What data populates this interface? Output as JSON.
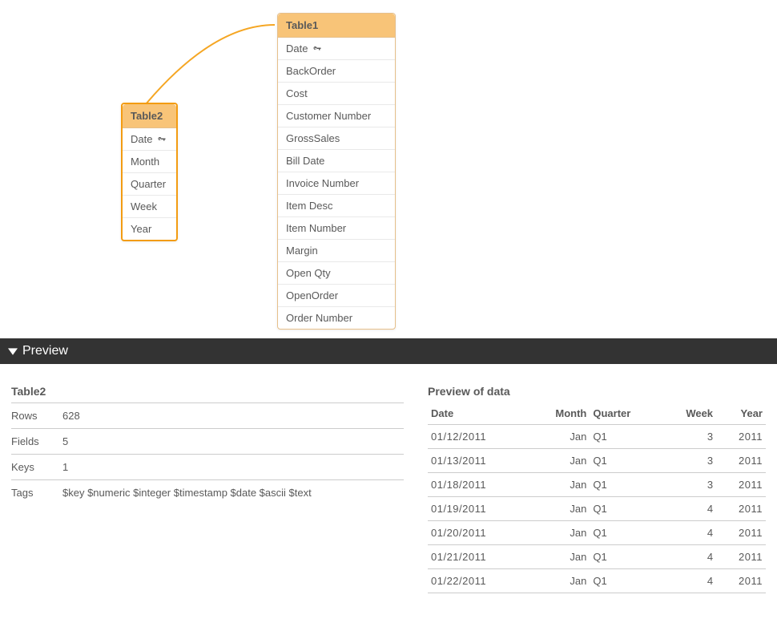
{
  "canvas": {
    "table1": {
      "title": "Table1",
      "fields": [
        "Date",
        "BackOrder",
        "Cost",
        "Customer Number",
        "GrossSales",
        "Bill Date",
        "Invoice Number",
        "Item Desc",
        "Item Number",
        "Margin",
        "Open Qty",
        "OpenOrder",
        "Order Number"
      ],
      "key_field_index": 0
    },
    "table2": {
      "title": "Table2",
      "fields": [
        "Date",
        "Month",
        "Quarter",
        "Week",
        "Year"
      ],
      "key_field_index": 0
    }
  },
  "preview": {
    "header_label": "Preview",
    "meta": {
      "title": "Table2",
      "rows_label": "Rows",
      "rows_value": "628",
      "fields_label": "Fields",
      "fields_value": "5",
      "keys_label": "Keys",
      "keys_value": "1",
      "tags_label": "Tags",
      "tags_value": "$key $numeric $integer $timestamp $date $ascii $text"
    },
    "data": {
      "title": "Preview of data",
      "columns": [
        "Date",
        "Month",
        "Quarter",
        "Week",
        "Year"
      ],
      "rows": [
        {
          "date": "01/12/2011",
          "month": "Jan",
          "quarter": "Q1",
          "week": "3",
          "year": "2011"
        },
        {
          "date": "01/13/2011",
          "month": "Jan",
          "quarter": "Q1",
          "week": "3",
          "year": "2011"
        },
        {
          "date": "01/18/2011",
          "month": "Jan",
          "quarter": "Q1",
          "week": "3",
          "year": "2011"
        },
        {
          "date": "01/19/2011",
          "month": "Jan",
          "quarter": "Q1",
          "week": "4",
          "year": "2011"
        },
        {
          "date": "01/20/2011",
          "month": "Jan",
          "quarter": "Q1",
          "week": "4",
          "year": "2011"
        },
        {
          "date": "01/21/2011",
          "month": "Jan",
          "quarter": "Q1",
          "week": "4",
          "year": "2011"
        },
        {
          "date": "01/22/2011",
          "month": "Jan",
          "quarter": "Q1",
          "week": "4",
          "year": "2011"
        }
      ]
    }
  }
}
